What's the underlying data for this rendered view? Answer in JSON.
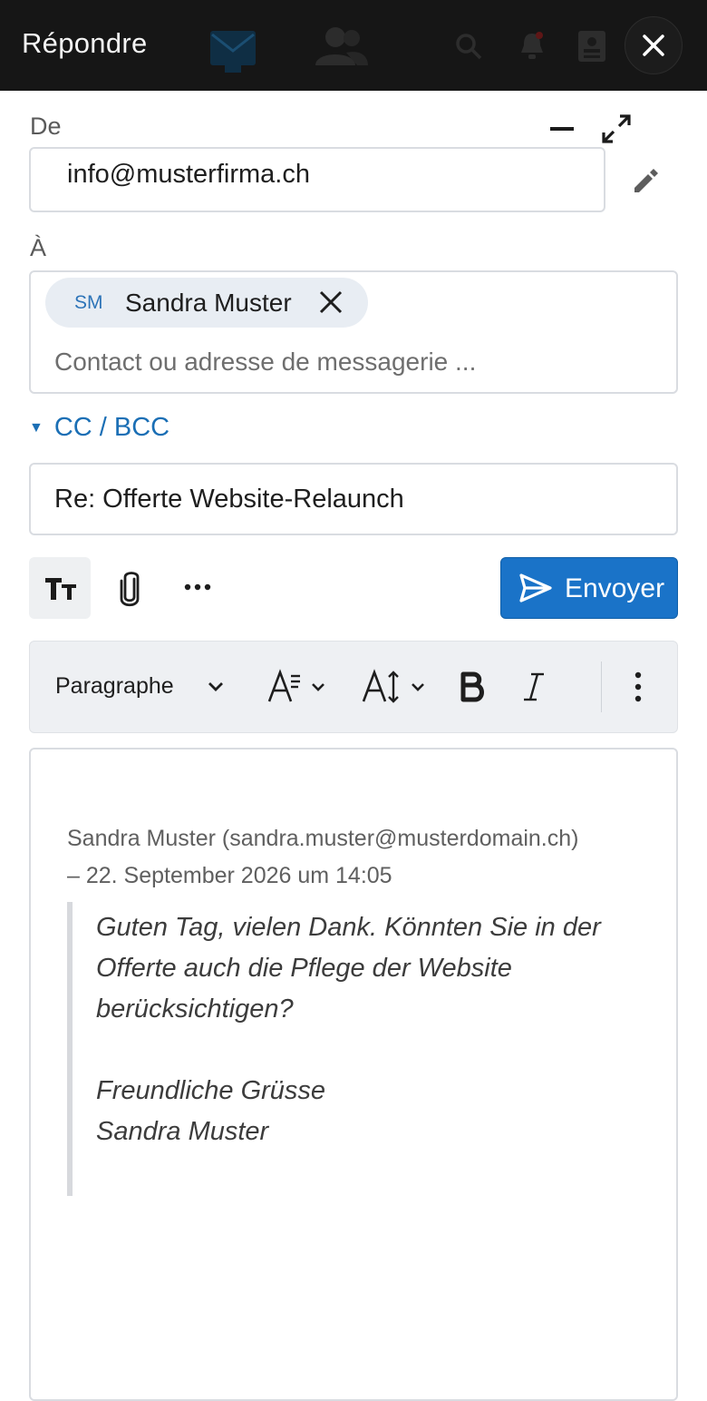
{
  "header": {
    "title": "Répondre",
    "background_icons": [
      "mail-icon",
      "contacts-icon",
      "search-icon",
      "bell-icon",
      "address-book-icon"
    ]
  },
  "from": {
    "label": "De",
    "value": "info@musterfirma.ch"
  },
  "to": {
    "label": "À",
    "recipients": [
      {
        "initials": "SM",
        "name": "Sandra Muster"
      }
    ],
    "placeholder": "Contact ou adresse de messagerie ..."
  },
  "cc_bcc": {
    "label": "CC / BCC",
    "expanded": false
  },
  "subject": {
    "value": "Re: Offerte Website-Relaunch"
  },
  "toolbar": {
    "send_label": "Envoyer"
  },
  "format_bar": {
    "block_style": "Paragraphe"
  },
  "message": {
    "attribution_line1": "Sandra Muster (sandra.muster@musterdomain.ch)",
    "attribution_line2": "– 22. September 2026 um 14:05",
    "quote_lines": [
      "Guten Tag, vielen Dank. Könnten Sie in der",
      "Offerte auch die Pflege der Website",
      "berücksichtigen?"
    ],
    "signature_lines": [
      "Freundliche Grüsse",
      "Sandra Muster"
    ]
  },
  "colors": {
    "header_bg": "#161616",
    "accent": "#1a73c8",
    "link": "#1b6fb5"
  }
}
